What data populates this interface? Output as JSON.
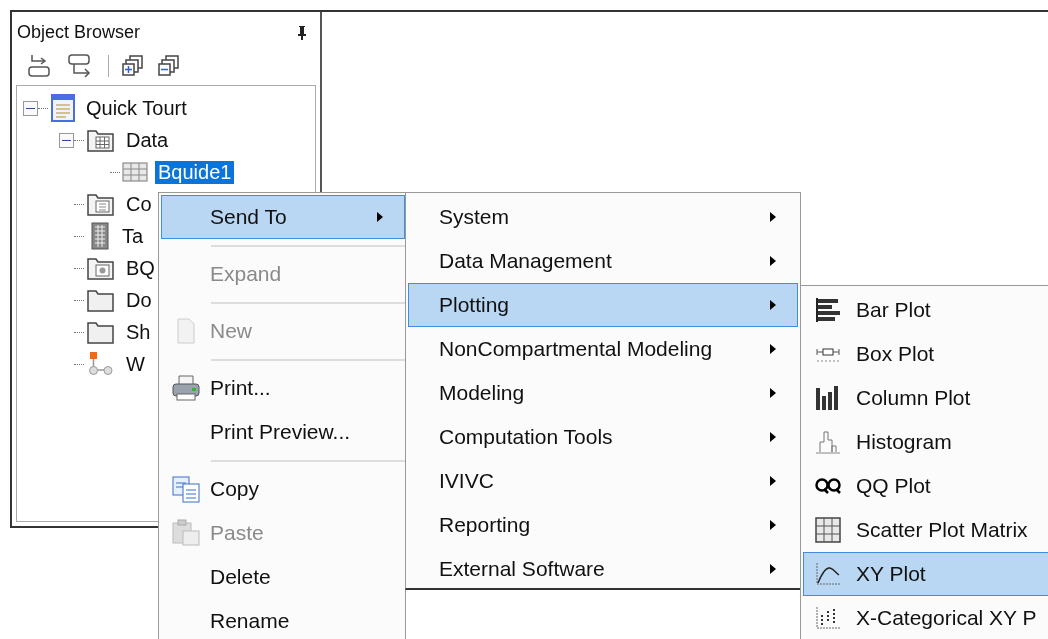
{
  "panel": {
    "title": "Object Browser"
  },
  "tree": [
    {
      "label": "Quick Tourt",
      "kind": "project",
      "expanded": true,
      "selected": false,
      "children": [
        {
          "label": "Data",
          "kind": "datafolder",
          "expanded": true,
          "selected": false,
          "children": [
            {
              "label": "Bquide1",
              "kind": "table",
              "selected": true
            }
          ]
        },
        {
          "label": "Co",
          "kind": "codefolder",
          "selected": false
        },
        {
          "label": "Ta",
          "kind": "tables",
          "selected": false
        },
        {
          "label": "BQ",
          "kind": "bqfolder",
          "selected": false
        },
        {
          "label": "Do",
          "kind": "folder",
          "selected": false
        },
        {
          "label": "Sh",
          "kind": "folder",
          "selected": false
        },
        {
          "label": "W",
          "kind": "workflow",
          "selected": false
        }
      ]
    }
  ],
  "context_menu": [
    {
      "kind": "item",
      "label": "Send To",
      "selected": true,
      "disabled": false,
      "has_submenu": true
    },
    {
      "kind": "separator"
    },
    {
      "kind": "item",
      "label": "Expand",
      "selected": false,
      "disabled": true,
      "has_submenu": false
    },
    {
      "kind": "separator"
    },
    {
      "kind": "item",
      "label": "New",
      "selected": false,
      "disabled": true,
      "has_submenu": false
    },
    {
      "kind": "separator"
    },
    {
      "kind": "item",
      "label": "Print...",
      "selected": false,
      "disabled": false,
      "has_submenu": false
    },
    {
      "kind": "item",
      "label": "Print Preview...",
      "selected": false,
      "disabled": false,
      "has_submenu": false
    },
    {
      "kind": "separator"
    },
    {
      "kind": "item",
      "label": "Copy",
      "selected": false,
      "disabled": false,
      "has_submenu": false
    },
    {
      "kind": "item",
      "label": "Paste",
      "selected": false,
      "disabled": true,
      "has_submenu": false
    },
    {
      "kind": "item",
      "label": "Delete",
      "selected": false,
      "disabled": false,
      "has_submenu": false
    },
    {
      "kind": "item",
      "label": "Rename",
      "selected": false,
      "disabled": false,
      "has_submenu": false
    }
  ],
  "send_to_menu": [
    {
      "label": "System",
      "selected": false,
      "has_submenu": true
    },
    {
      "label": "Data Management",
      "selected": false,
      "has_submenu": true
    },
    {
      "label": "Plotting",
      "selected": true,
      "has_submenu": true
    },
    {
      "label": "NonCompartmental Modeling",
      "selected": false,
      "has_submenu": true
    },
    {
      "label": "Modeling",
      "selected": false,
      "has_submenu": true
    },
    {
      "label": "Computation Tools",
      "selected": false,
      "has_submenu": true
    },
    {
      "label": "IVIVC",
      "selected": false,
      "has_submenu": true
    },
    {
      "label": "Reporting",
      "selected": false,
      "has_submenu": true
    },
    {
      "label": "External Software",
      "selected": false,
      "has_submenu": true
    }
  ],
  "plotting_menu": [
    {
      "label": "Bar Plot",
      "selected": false
    },
    {
      "label": "Box Plot",
      "selected": false
    },
    {
      "label": "Column Plot",
      "selected": false
    },
    {
      "label": "Histogram",
      "selected": false
    },
    {
      "label": "QQ Plot",
      "selected": false
    },
    {
      "label": "Scatter Plot Matrix",
      "selected": false
    },
    {
      "label": "XY Plot",
      "selected": true
    },
    {
      "label": "X-Categorical XY P",
      "selected": false
    }
  ]
}
